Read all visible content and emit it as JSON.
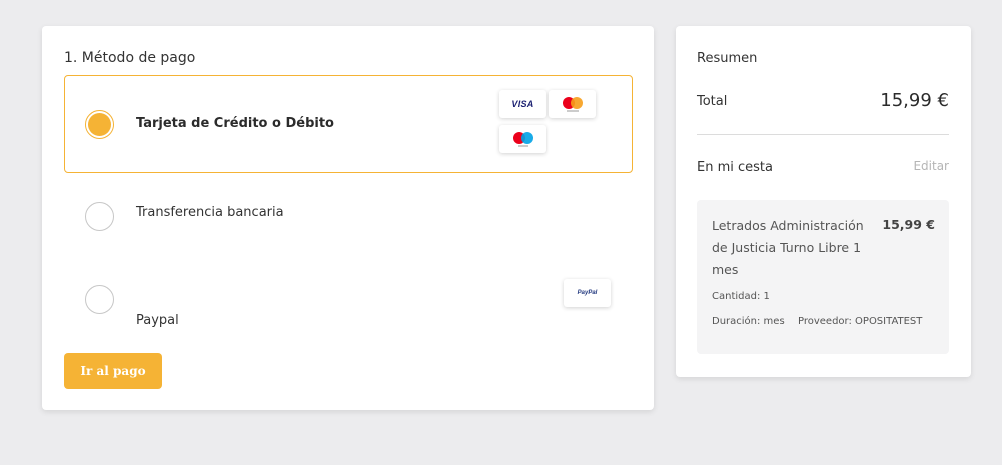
{
  "payment": {
    "title": "1.  Método de pago",
    "options": [
      {
        "label": "Tarjeta de Crédito o Débito",
        "selected": true,
        "logos": [
          "visa-logo",
          "mastercard-logo",
          "maestro-logo"
        ]
      },
      {
        "label": "Transferencia bancaria",
        "selected": false,
        "logos": []
      },
      {
        "label": "Paypal",
        "selected": false,
        "logos": [
          "paypal-logo"
        ]
      }
    ],
    "logo_text": {
      "visa": "VISA",
      "paypal": "PayPal"
    },
    "pay_button": "Ir al pago"
  },
  "summary": {
    "title": "Resumen",
    "total_label": "Total",
    "total_value": "15,99 €",
    "basket_label": "En mi cesta",
    "edit_label": "Editar",
    "item": {
      "name": "Letrados Administración de Justicia Turno Libre 1 mes",
      "price": "15,99 €",
      "quantity": "Cantidad: 1",
      "duration": "Duración: mes",
      "provider": "Proveedor: OPOSITATEST"
    }
  },
  "colors": {
    "accent": "#f5b335",
    "background": "#ececee",
    "mastercard_red": "#eb001b",
    "mastercard_yellow": "#f79e1b",
    "maestro_blue": "#00a2e5"
  }
}
